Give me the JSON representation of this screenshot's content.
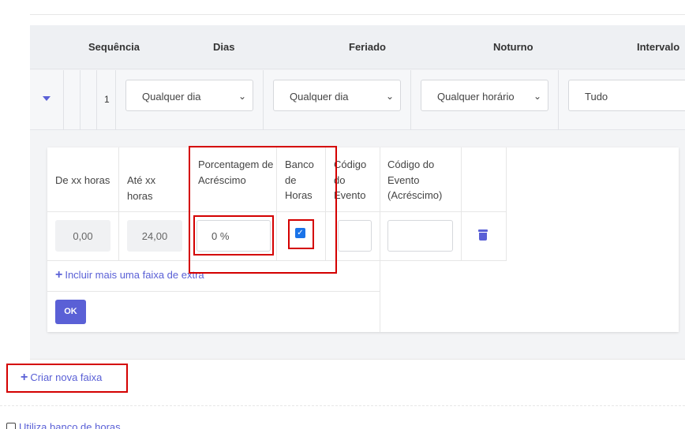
{
  "header": {
    "sequencia": "Sequência",
    "dias": "Dias",
    "feriado": "Feriado",
    "noturno": "Noturno",
    "intervalo": "Intervalo"
  },
  "row": {
    "sequence": "1",
    "dias_value": "Qualquer dia",
    "feriado_value": "Qualquer dia",
    "noturno_value": "Qualquer horário",
    "intervalo_value": "Tudo"
  },
  "faixa": {
    "col_de": "De xx horas",
    "col_ate": "Até xx horas",
    "col_porcentagem": "Porcentagem de Acréscimo",
    "col_banco": "Banco de Horas",
    "col_codigo": "Código do Evento",
    "col_codigo_acrescimo": "Código do Evento (Acréscimo)",
    "de_value": "0,00",
    "ate_value": "24,00",
    "porcentagem_value": "0 %",
    "banco_checked": true,
    "add_link": "Incluir mais uma faixa de extra",
    "ok_label": "OK"
  },
  "criar_nova_faixa": "Criar nova faixa",
  "utiliza_banco": "Utiliza banco de horas",
  "colors": {
    "accent": "#5a60d6",
    "highlight": "#d40000",
    "checkbox": "#1a73e8"
  },
  "icons": [
    "caret-down-icon",
    "chevron-down-icon",
    "plus-icon",
    "trash-icon",
    "check-icon"
  ]
}
